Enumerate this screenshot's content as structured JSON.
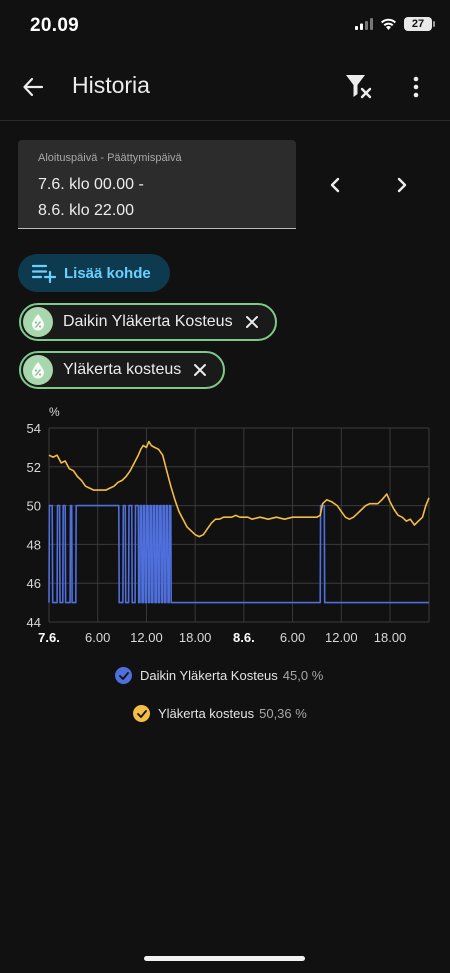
{
  "status": {
    "time": "20.09",
    "battery": "27"
  },
  "header": {
    "title": "Historia"
  },
  "date_range": {
    "label": "Aloituspäivä - Päättymispäivä",
    "start": "7.6. klo 00.00 -",
    "end": "8.6. klo 22.00"
  },
  "add_button": {
    "label": "Lisää kohde"
  },
  "chips": [
    {
      "label": "Daikin Yläkerta Kosteus"
    },
    {
      "label": "Yläkerta kosteus"
    }
  ],
  "colors": {
    "series1": "#4e6fdc",
    "series2": "#f4bd45",
    "chip_border": "#7fc98a",
    "accent": "#6ad0ff"
  },
  "chart_data": {
    "type": "line",
    "ylabel": "%",
    "ylim": [
      44,
      54
    ],
    "yticks": [
      44,
      46,
      48,
      50,
      52,
      54
    ],
    "xlim": [
      0,
      46.8
    ],
    "xticks": [
      {
        "x": 0,
        "label": "7.6."
      },
      {
        "x": 6,
        "label": "6.00"
      },
      {
        "x": 12,
        "label": "12.00"
      },
      {
        "x": 18,
        "label": "18.00"
      },
      {
        "x": 24,
        "label": "8.6."
      },
      {
        "x": 30,
        "label": "6.00"
      },
      {
        "x": 36,
        "label": "12.00"
      },
      {
        "x": 42,
        "label": "18.00"
      }
    ],
    "series": [
      {
        "name": "Daikin Yläkerta Kosteus",
        "current": "45,0 %",
        "color": "#4e6fdc",
        "points": [
          [
            0,
            45
          ],
          [
            0.05,
            50
          ],
          [
            0.4,
            50
          ],
          [
            0.45,
            45
          ],
          [
            1.0,
            45
          ],
          [
            1.05,
            50
          ],
          [
            1.3,
            50
          ],
          [
            1.35,
            45
          ],
          [
            1.7,
            45
          ],
          [
            1.75,
            50
          ],
          [
            2.0,
            50
          ],
          [
            2.05,
            45
          ],
          [
            2.6,
            45
          ],
          [
            2.65,
            50
          ],
          [
            2.8,
            50
          ],
          [
            2.85,
            45
          ],
          [
            3.3,
            45
          ],
          [
            3.35,
            50
          ],
          [
            8.6,
            50
          ],
          [
            8.65,
            45
          ],
          [
            9.1,
            45
          ],
          [
            9.15,
            50
          ],
          [
            9.4,
            50
          ],
          [
            9.45,
            45
          ],
          [
            9.8,
            45
          ],
          [
            9.85,
            50
          ],
          [
            10.2,
            50
          ],
          [
            10.25,
            45
          ],
          [
            10.6,
            45
          ],
          [
            10.65,
            50
          ],
          [
            11.0,
            50
          ],
          [
            11.05,
            45
          ],
          [
            11.2,
            45
          ],
          [
            11.25,
            50
          ],
          [
            11.4,
            50
          ],
          [
            11.45,
            45
          ],
          [
            11.6,
            45
          ],
          [
            11.65,
            50
          ],
          [
            11.8,
            50
          ],
          [
            11.85,
            45
          ],
          [
            12.0,
            45
          ],
          [
            12.05,
            50
          ],
          [
            12.2,
            50
          ],
          [
            12.25,
            45
          ],
          [
            12.4,
            45
          ],
          [
            12.45,
            50
          ],
          [
            12.6,
            50
          ],
          [
            12.65,
            45
          ],
          [
            12.8,
            45
          ],
          [
            12.85,
            50
          ],
          [
            13.0,
            50
          ],
          [
            13.05,
            45
          ],
          [
            13.2,
            45
          ],
          [
            13.25,
            50
          ],
          [
            13.4,
            50
          ],
          [
            13.45,
            45
          ],
          [
            13.6,
            45
          ],
          [
            13.65,
            50
          ],
          [
            13.8,
            50
          ],
          [
            13.85,
            45
          ],
          [
            14.0,
            45
          ],
          [
            14.05,
            50
          ],
          [
            14.2,
            50
          ],
          [
            14.25,
            45
          ],
          [
            14.4,
            45
          ],
          [
            14.45,
            50
          ],
          [
            14.6,
            50
          ],
          [
            14.65,
            45
          ],
          [
            14.8,
            45
          ],
          [
            14.85,
            50
          ],
          [
            15.0,
            50
          ],
          [
            15.05,
            45
          ],
          [
            33.4,
            45
          ],
          [
            33.45,
            50
          ],
          [
            33.9,
            50
          ],
          [
            33.95,
            45
          ],
          [
            46.8,
            45
          ]
        ]
      },
      {
        "name": "Yläkerta kosteus",
        "current": "50,36 %",
        "color": "#f4bd45",
        "points": [
          [
            0,
            52.6
          ],
          [
            0.5,
            52.5
          ],
          [
            1,
            52.6
          ],
          [
            1.5,
            52.2
          ],
          [
            2,
            52.3
          ],
          [
            2.5,
            51.9
          ],
          [
            3,
            51.8
          ],
          [
            3.5,
            51.5
          ],
          [
            4,
            51.3
          ],
          [
            4.5,
            51.0
          ],
          [
            5,
            50.9
          ],
          [
            5.5,
            50.8
          ],
          [
            6,
            50.8
          ],
          [
            6.5,
            50.8
          ],
          [
            7,
            50.8
          ],
          [
            7.5,
            50.9
          ],
          [
            8,
            51.0
          ],
          [
            8.5,
            51.2
          ],
          [
            9,
            51.3
          ],
          [
            9.5,
            51.5
          ],
          [
            10,
            51.8
          ],
          [
            10.5,
            52.2
          ],
          [
            11,
            52.6
          ],
          [
            11.3,
            52.9
          ],
          [
            11.6,
            53.1
          ],
          [
            12,
            53.0
          ],
          [
            12.3,
            53.3
          ],
          [
            12.6,
            53.1
          ],
          [
            13,
            53.0
          ],
          [
            13.5,
            52.9
          ],
          [
            14,
            52.6
          ],
          [
            14.5,
            51.8
          ],
          [
            15,
            51.0
          ],
          [
            15.5,
            50.3
          ],
          [
            16,
            49.7
          ],
          [
            16.5,
            49.3
          ],
          [
            17,
            48.9
          ],
          [
            17.5,
            48.7
          ],
          [
            18,
            48.5
          ],
          [
            18.5,
            48.4
          ],
          [
            19,
            48.5
          ],
          [
            19.5,
            48.8
          ],
          [
            20,
            49.1
          ],
          [
            20.5,
            49.3
          ],
          [
            21,
            49.3
          ],
          [
            21.5,
            49.4
          ],
          [
            22,
            49.4
          ],
          [
            22.5,
            49.4
          ],
          [
            23,
            49.5
          ],
          [
            23.5,
            49.4
          ],
          [
            24,
            49.4
          ],
          [
            24.5,
            49.4
          ],
          [
            25,
            49.3
          ],
          [
            26,
            49.4
          ],
          [
            27,
            49.3
          ],
          [
            28,
            49.4
          ],
          [
            29,
            49.3
          ],
          [
            30,
            49.4
          ],
          [
            31,
            49.4
          ],
          [
            32,
            49.4
          ],
          [
            33,
            49.4
          ],
          [
            33.4,
            49.5
          ],
          [
            33.7,
            50.1
          ],
          [
            34.2,
            50.3
          ],
          [
            34.8,
            50.2
          ],
          [
            35.5,
            50.0
          ],
          [
            36,
            49.7
          ],
          [
            36.5,
            49.4
          ],
          [
            37,
            49.3
          ],
          [
            37.5,
            49.4
          ],
          [
            38,
            49.6
          ],
          [
            38.5,
            49.8
          ],
          [
            39,
            50.0
          ],
          [
            39.5,
            50.1
          ],
          [
            40,
            50.1
          ],
          [
            40.5,
            50.1
          ],
          [
            41,
            50.3
          ],
          [
            41.6,
            50.6
          ],
          [
            42,
            50.2
          ],
          [
            42.5,
            49.8
          ],
          [
            43,
            49.5
          ],
          [
            43.5,
            49.4
          ],
          [
            44,
            49.2
          ],
          [
            44.5,
            49.3
          ],
          [
            45,
            49.0
          ],
          [
            45.5,
            49.2
          ],
          [
            46,
            49.4
          ],
          [
            46.4,
            50.0
          ],
          [
            46.8,
            50.4
          ]
        ]
      }
    ]
  }
}
